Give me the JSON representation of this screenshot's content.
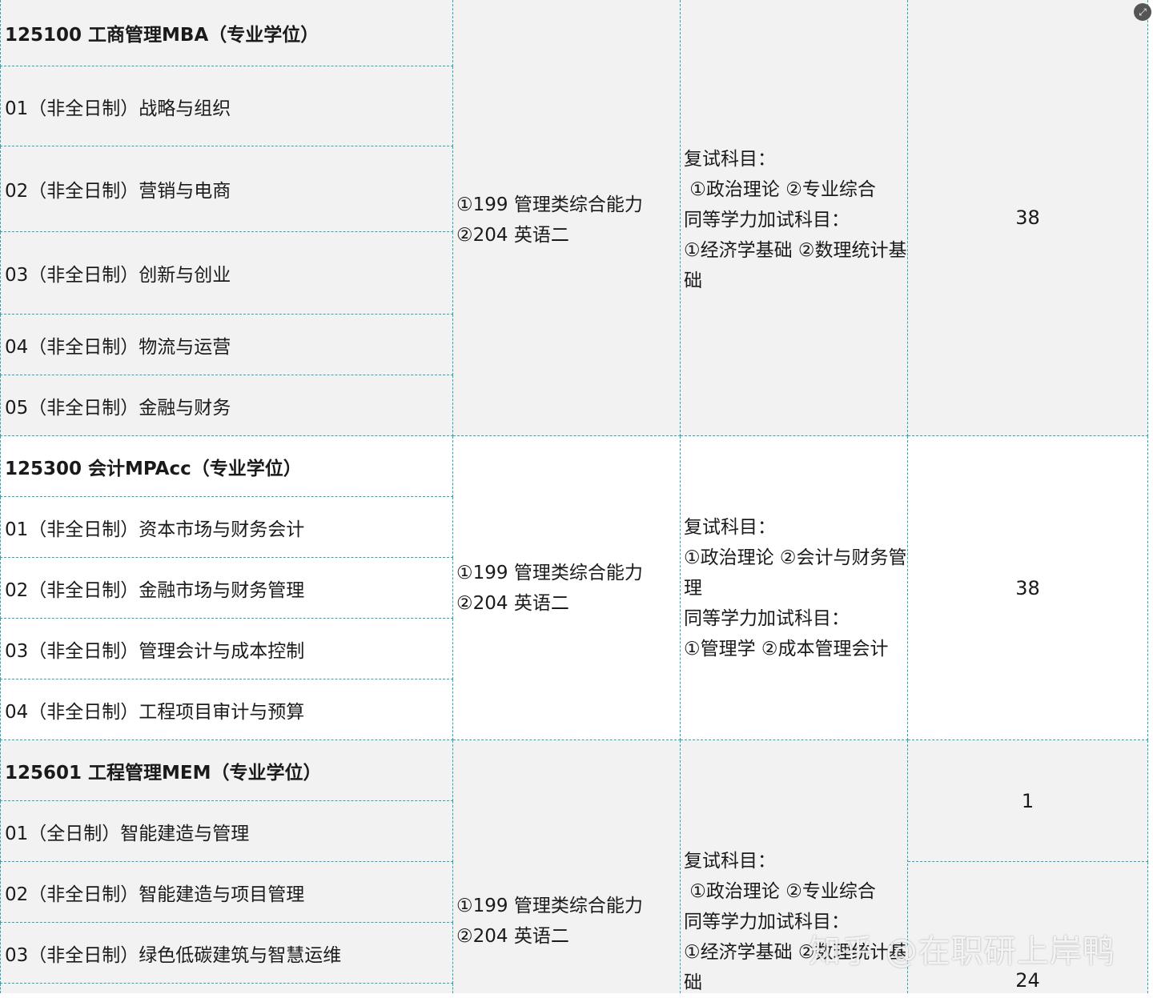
{
  "sections": [
    {
      "header": "125100 工商管理MBA（专业学位）",
      "items": [
        "01（非全日制）战略与组织",
        "02（非全日制）营销与电商",
        "03（非全日制）创新与创业",
        "04（非全日制）物流与运营",
        "05（非全日制）金融与财务"
      ],
      "exam_lines": [
        "①199 管理类综合能力",
        "②204 英语二"
      ],
      "retest_lines": [
        "复试科目：",
        " ①政治理论 ②专业综合",
        "同等学力加试科目：",
        "①经济学基础 ②数理统计基",
        "础"
      ],
      "quota": "38"
    },
    {
      "header": "125300 会计MPAcc（专业学位）",
      "items": [
        "01（非全日制）资本市场与财务会计",
        "02（非全日制）金融市场与财务管理",
        "03（非全日制）管理会计与成本控制",
        "04（非全日制）工程项目审计与预算"
      ],
      "exam_lines": [
        "①199 管理类综合能力",
        "②204 英语二"
      ],
      "retest_lines": [
        "复试科目：",
        "①政治理论 ②会计与财务管",
        "理",
        "同等学力加试科目：",
        "①管理学 ②成本管理会计"
      ],
      "quota": "38"
    },
    {
      "header": "125601 工程管理MEM（专业学位）",
      "items": [
        "01（全日制）智能建造与管理",
        "02（非全日制）智能建造与项目管理",
        "03（非全日制）绿色低碳建筑与智慧运维"
      ],
      "exam_lines": [
        "①199 管理类综合能力",
        "②204 英语二"
      ],
      "retest_lines": [
        "复试科目：",
        " ①政治理论 ②专业综合",
        "同等学力加试科目：",
        "①经济学基础 ②数理统计基",
        "础"
      ],
      "quota_top": "1",
      "quota_bottom": "24"
    }
  ],
  "watermark": "知乎 @在职研上岸鸭",
  "colors": {
    "border": "#2aa7b4",
    "gray_row": "#f2f2f2",
    "white_row": "#ffffff"
  }
}
